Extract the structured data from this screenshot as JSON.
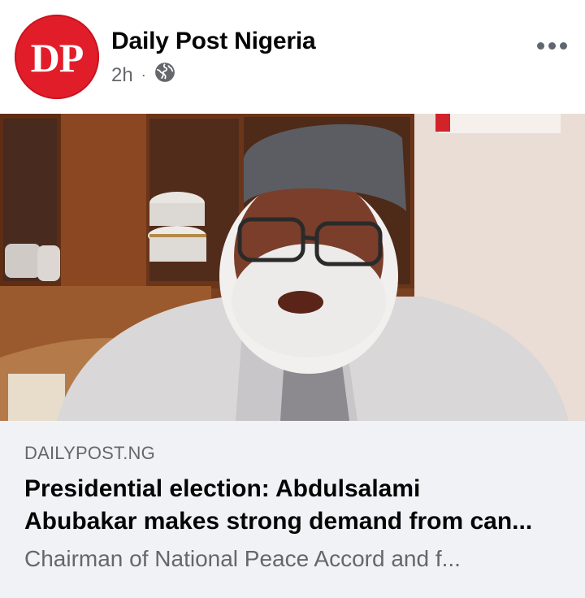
{
  "post": {
    "avatar_text": "DP",
    "page_name": "Daily Post Nigeria",
    "time": "2h",
    "separator": "·",
    "privacy_icon": "globe-icon",
    "more_icon": "more-options-icon"
  },
  "link_preview": {
    "domain": "DAILYPOST.NG",
    "headline_line1": "Presidential election: Abdulsalami",
    "headline_line2": "Abubakar makes strong demand from can...",
    "description": "Chairman of National Peace Accord and f..."
  },
  "colors": {
    "brand_red": "#e21d2a",
    "text_primary": "#050505",
    "text_secondary": "#65676b",
    "link_box_bg": "#f0f2f5"
  }
}
